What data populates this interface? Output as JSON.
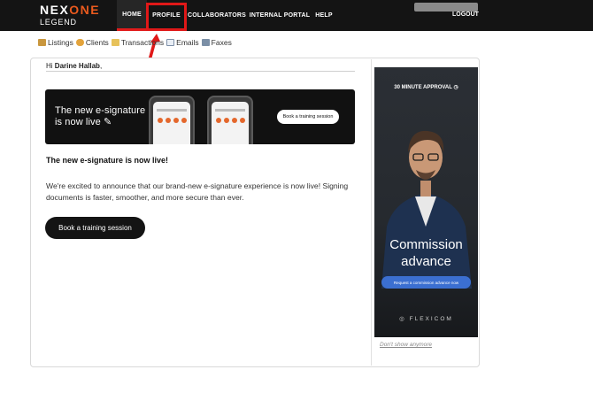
{
  "logo": {
    "brand_a": "NEX",
    "brand_b": "ONE",
    "sub": "LEGEND"
  },
  "nav": {
    "home": "HOME",
    "profile": "PROFILE",
    "collaborators": "COLLABORATORS",
    "internal_portal": "INTERNAL PORTAL",
    "help": "HELP",
    "logout": "LOGOUT"
  },
  "subnav": {
    "listings": "Listings",
    "clients": "Clients",
    "transactions": "Transactions",
    "emails": "Emails",
    "faxes": "Faxes"
  },
  "message": {
    "greeting_prefix": "Hi",
    "user_name": "Darine Hallab",
    "greeting_suffix": ",",
    "banner_text_line1": "The new e-signature",
    "banner_text_line2": "is now live",
    "banner_button": "Book a training session",
    "headline": "The new e-signature is now live!",
    "body": "We're excited to announce that our brand-new e-signature experience is now live! Signing documents is faster, smoother, and more secure than ever.",
    "cta": "Book a training session"
  },
  "ad": {
    "top_text": "30 MINUTE APPROVAL",
    "title_line1": "Commission",
    "title_line2": "advance",
    "button": "Request a commission advance now",
    "brand": "FLEXICOM"
  },
  "dont_show": "Don't show anymore",
  "colors": {
    "topbar": "#141414",
    "accent_orange": "#ea5a1e",
    "annotation_red": "#e01818",
    "ad_button": "#3b6fd1"
  }
}
